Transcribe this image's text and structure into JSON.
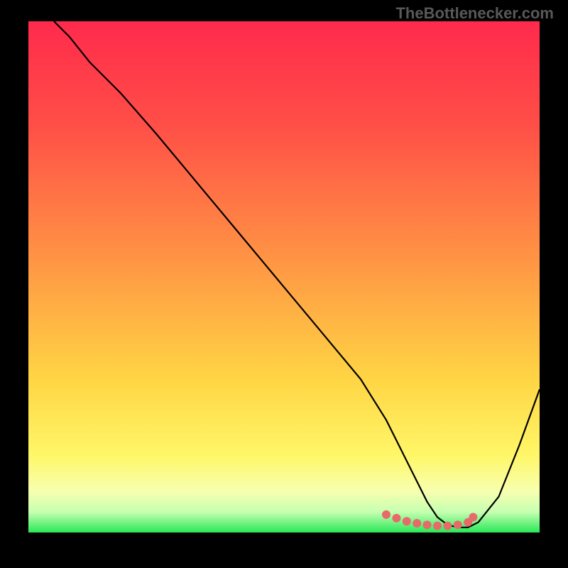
{
  "watermark": "TheBottlenecker.com",
  "chart_data": {
    "type": "line",
    "title": "",
    "xlabel": "",
    "ylabel": "",
    "xlim": [
      0,
      100
    ],
    "ylim": [
      0,
      100
    ],
    "grid": false,
    "series": [
      {
        "name": "curve",
        "x": [
          5,
          8,
          12,
          18,
          25,
          30,
          35,
          40,
          45,
          50,
          55,
          60,
          65,
          70,
          73,
          76,
          78,
          80,
          82,
          84,
          86,
          88,
          92,
          96,
          100
        ],
        "values": [
          100,
          97,
          92,
          86,
          78,
          72,
          66,
          60,
          54,
          48,
          42,
          36,
          30,
          22,
          16,
          10,
          6,
          3,
          1.5,
          1,
          1,
          2,
          7,
          17,
          28
        ]
      }
    ],
    "markers": {
      "name": "highlight",
      "x": [
        70,
        72,
        74,
        76,
        78,
        80,
        82,
        84,
        86,
        87
      ],
      "values": [
        3.5,
        2.8,
        2.2,
        1.8,
        1.5,
        1.3,
        1.3,
        1.5,
        2.0,
        3.0
      ]
    },
    "gradient_stops": [
      {
        "offset": 0,
        "color": "#FF2A4C"
      },
      {
        "offset": 20,
        "color": "#FF4E47"
      },
      {
        "offset": 45,
        "color": "#FF9044"
      },
      {
        "offset": 70,
        "color": "#FFD544"
      },
      {
        "offset": 85,
        "color": "#FFF768"
      },
      {
        "offset": 92,
        "color": "#F7FFB0"
      },
      {
        "offset": 96,
        "color": "#C6FFB0"
      },
      {
        "offset": 100,
        "color": "#28E858"
      }
    ],
    "curve_color": "#000000",
    "marker_color": "#E76A6A",
    "marker_radius": 6
  }
}
